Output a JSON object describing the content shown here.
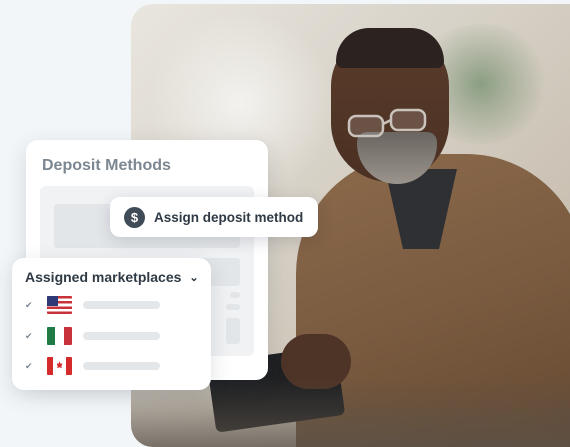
{
  "deposit_card": {
    "title": "Deposit Methods"
  },
  "assign_chip": {
    "icon": "dollar-icon",
    "label": "Assign deposit method"
  },
  "marketplaces_card": {
    "title": "Assigned marketplaces",
    "dropdown_icon": "chevron-down-icon",
    "rows": [
      {
        "checked": true,
        "flag": "us-flag-icon"
      },
      {
        "checked": true,
        "flag": "mexico-flag-icon"
      },
      {
        "checked": true,
        "flag": "canada-flag-icon"
      }
    ]
  },
  "colors": {
    "background": "#f3f6f8",
    "card": "#ffffff",
    "title_muted": "#7c8791",
    "text_dark": "#2f3a44",
    "icon_dark": "#3f4b56"
  }
}
